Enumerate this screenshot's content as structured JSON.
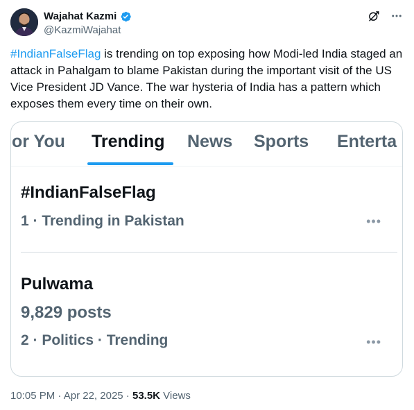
{
  "author": {
    "display_name": "Wajahat Kazmi",
    "handle": "@KazmiWajahat"
  },
  "tweet": {
    "hashtag": "#IndianFalseFlag",
    "text_rest": " is trending on top exposing how Modi-led India staged an attack in Pahalgam to blame Pakistan during the important visit of the US Vice President JD Vance. The war hysteria of India has a pattern which exposes them every time on their own."
  },
  "media": {
    "tabs": [
      {
        "label": "or You"
      },
      {
        "label": "Trending"
      },
      {
        "label": "News"
      },
      {
        "label": "Sports"
      },
      {
        "label": "Enterta"
      }
    ],
    "trends": [
      {
        "title": "#IndianFalseFlag",
        "meta": "1 · Trending in Pakistan",
        "more": "•••"
      },
      {
        "title": "Pulwama",
        "posts": "9,829 posts",
        "meta": "2 · Politics · Trending",
        "more": "•••"
      }
    ]
  },
  "footer": {
    "time": "10:05 PM",
    "sep1": " · ",
    "date": "Apr 22, 2025",
    "sep2": " · ",
    "views_count": "53.5K",
    "views_label": " Views"
  },
  "colors": {
    "accent": "#1d9bf0",
    "text_primary": "#0f1419",
    "text_secondary": "#536471"
  },
  "icons": [
    "verified-badge-icon",
    "grok-icon",
    "more-options-icon"
  ]
}
